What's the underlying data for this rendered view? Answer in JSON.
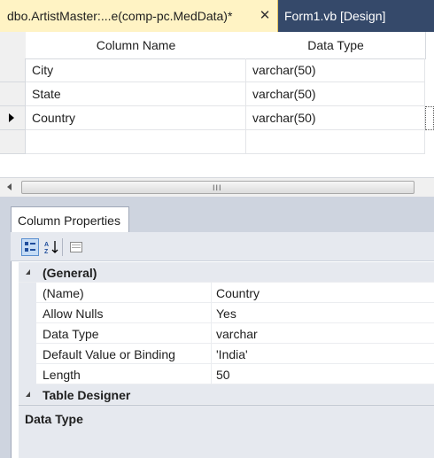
{
  "tabs": {
    "active": {
      "label": "dbo.ArtistMaster:...e(comp-pc.MedData)*",
      "close": "✕"
    },
    "form": {
      "label": "Form1.vb [Design]"
    }
  },
  "grid": {
    "headers": {
      "column_name": "Column Name",
      "data_type": "Data Type"
    },
    "rows": [
      {
        "name": "City",
        "type": "varchar(50)"
      },
      {
        "name": "State",
        "type": "varchar(50)"
      },
      {
        "name": "Country",
        "type": "varchar(50)"
      }
    ]
  },
  "scrollbar": {
    "grip": "III"
  },
  "properties": {
    "tab_label": "Column Properties",
    "toolbar": {
      "categorized_icon": "categorized-icon",
      "alphabetical_icon": "alphabetical-sort-icon",
      "pages_icon": "property-pages-icon"
    },
    "categories": {
      "general": "(General)",
      "table_designer": "Table Designer"
    },
    "items": [
      {
        "name": "(Name)",
        "value": "Country"
      },
      {
        "name": "Allow Nulls",
        "value": "Yes"
      },
      {
        "name": "Data Type",
        "value": "varchar"
      },
      {
        "name": "Default Value or Binding",
        "value": "'India'"
      },
      {
        "name": "Length",
        "value": "50"
      }
    ],
    "description_title": "Data Type"
  }
}
